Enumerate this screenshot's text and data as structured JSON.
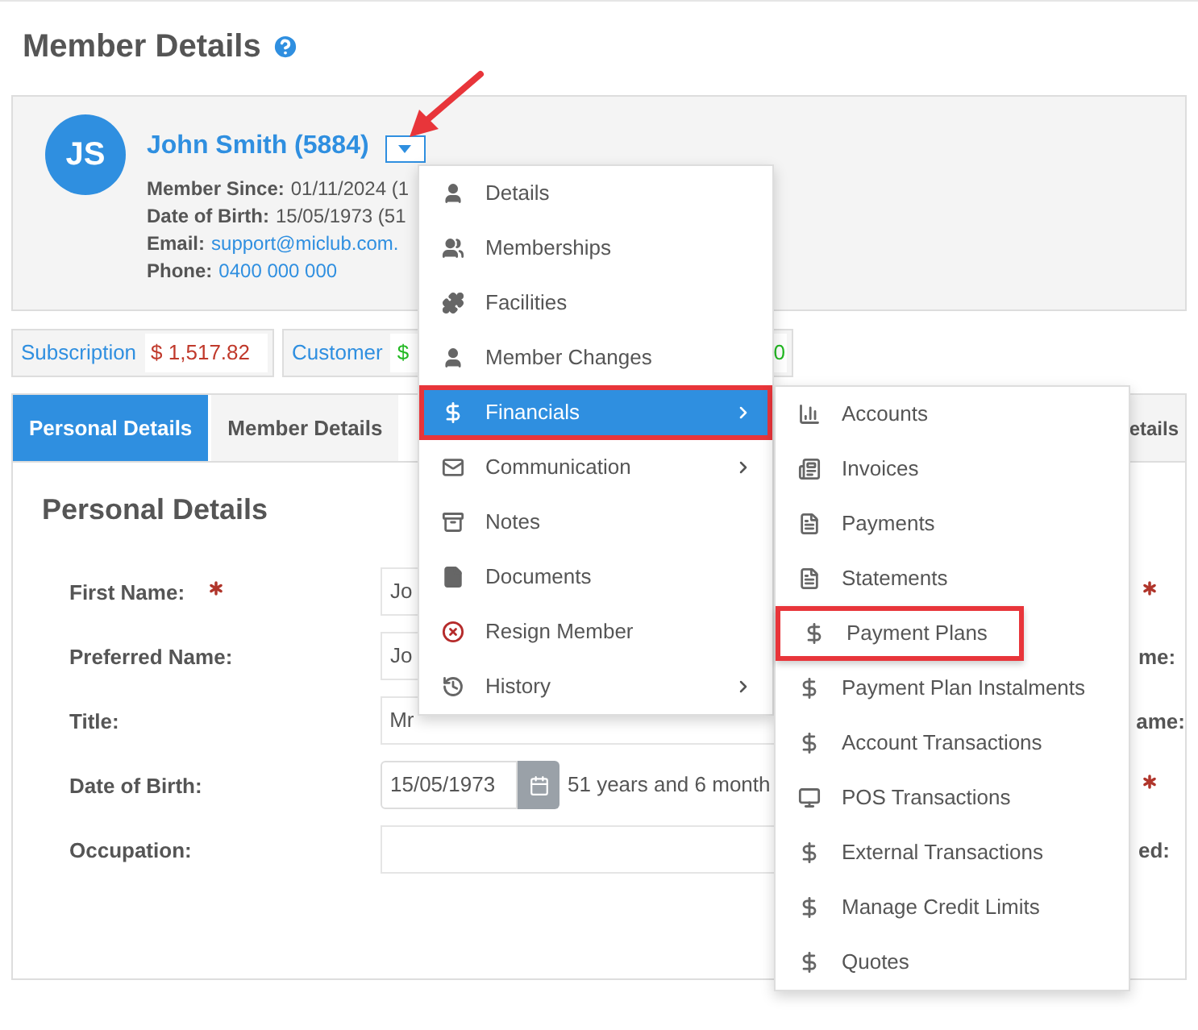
{
  "page_title": "Member Details",
  "member": {
    "initials": "JS",
    "name": "John Smith (5884)",
    "details": [
      {
        "label": "Member Since:",
        "value": "01/11/2024 (1",
        "kind": "text"
      },
      {
        "label": "Date of Birth:",
        "value": "15/05/1973 (51",
        "kind": "text"
      },
      {
        "label": "Email:",
        "value": "support@miclub.com.",
        "kind": "link"
      },
      {
        "label": "Phone:",
        "value": "0400 000 000",
        "kind": "link"
      }
    ]
  },
  "summary": [
    {
      "label": "Subscription",
      "value": "$ 1,517.82",
      "color": "#c0392b"
    },
    {
      "label": "Customer",
      "value": "$",
      "value_end": "0",
      "color": "#22b922"
    }
  ],
  "tabs": [
    {
      "label": "Personal Details",
      "selected": true
    },
    {
      "label": "Member Details",
      "selected": false
    },
    {
      "label": "etails",
      "selected": false
    }
  ],
  "section_title": "Personal Details",
  "form": [
    {
      "label": "First Name:",
      "required": true,
      "kind": "text",
      "value": "Jo",
      "column_2_required": true
    },
    {
      "label": "Preferred Name:",
      "required": false,
      "kind": "text",
      "value": "Jo",
      "column_2_label": "me:",
      "column_2_required": false
    },
    {
      "label": "Title:",
      "required": false,
      "kind": "text",
      "value": "Mr",
      "column_2_label": "ame:",
      "column_2_required": false
    },
    {
      "label": "Date of Birth:",
      "required": false,
      "kind": "date",
      "value": "15/05/1973",
      "note": "51 years and 6 month",
      "column_2_required": true
    },
    {
      "label": "Occupation:",
      "required": false,
      "kind": "text",
      "column_2_label": "ed:",
      "column_2_required": false
    }
  ],
  "menu": [
    {
      "label": "Details",
      "kind": "user",
      "selected": false,
      "highlighted": false,
      "submenu": false
    },
    {
      "label": "Memberships",
      "kind": "users",
      "selected": false,
      "highlighted": false,
      "submenu": false
    },
    {
      "label": "Facilities",
      "kind": "puzzle",
      "selected": false,
      "highlighted": false,
      "submenu": false
    },
    {
      "label": "Member Changes",
      "kind": "user",
      "selected": false,
      "highlighted": false,
      "submenu": false
    },
    {
      "label": "Financials",
      "kind": "dollar",
      "selected": true,
      "highlighted": true,
      "submenu": true
    },
    {
      "label": "Communication",
      "kind": "mail",
      "selected": false,
      "highlighted": false,
      "submenu": true
    },
    {
      "label": "Notes",
      "kind": "archive",
      "selected": false,
      "highlighted": false,
      "submenu": false
    },
    {
      "label": "Documents",
      "kind": "file",
      "selected": false,
      "highlighted": false,
      "submenu": false
    },
    {
      "label": "Resign Member",
      "kind": "cancel",
      "selected": false,
      "highlighted": false,
      "submenu": false
    },
    {
      "label": "History",
      "kind": "history",
      "selected": false,
      "highlighted": false,
      "submenu": true
    }
  ],
  "submenu": [
    {
      "label": "Accounts",
      "kind": "chart",
      "highlighted": false
    },
    {
      "label": "Invoices",
      "kind": "list",
      "highlighted": false
    },
    {
      "label": "Payments",
      "kind": "document",
      "highlighted": false
    },
    {
      "label": "Statements",
      "kind": "document",
      "highlighted": false
    },
    {
      "label": "Payment Plans",
      "kind": "dollar",
      "highlighted": true
    },
    {
      "label": "Payment Plan Instalments",
      "kind": "dollar",
      "highlighted": false
    },
    {
      "label": "Account Transactions",
      "kind": "dollar",
      "highlighted": false
    },
    {
      "label": "POS Transactions",
      "kind": "monitor",
      "highlighted": false
    },
    {
      "label": "External Transactions",
      "kind": "dollar",
      "highlighted": false
    },
    {
      "label": "Manage Credit Limits",
      "kind": "dollar",
      "highlighted": false
    },
    {
      "label": "Quotes",
      "kind": "dollar",
      "highlighted": false
    }
  ]
}
